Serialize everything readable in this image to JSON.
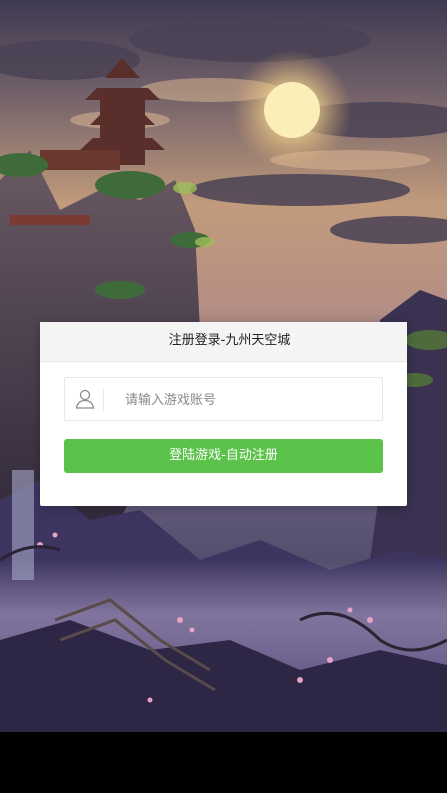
{
  "dialog": {
    "title": "注册登录-九州天空城",
    "account_input": {
      "value": "",
      "placeholder": "请输入游戏账号"
    },
    "login_button_label": "登陆游戏-自动注册",
    "icon": "user-icon",
    "colors": {
      "button": "#5cc34a",
      "header_background": "#f4f4f4"
    }
  }
}
